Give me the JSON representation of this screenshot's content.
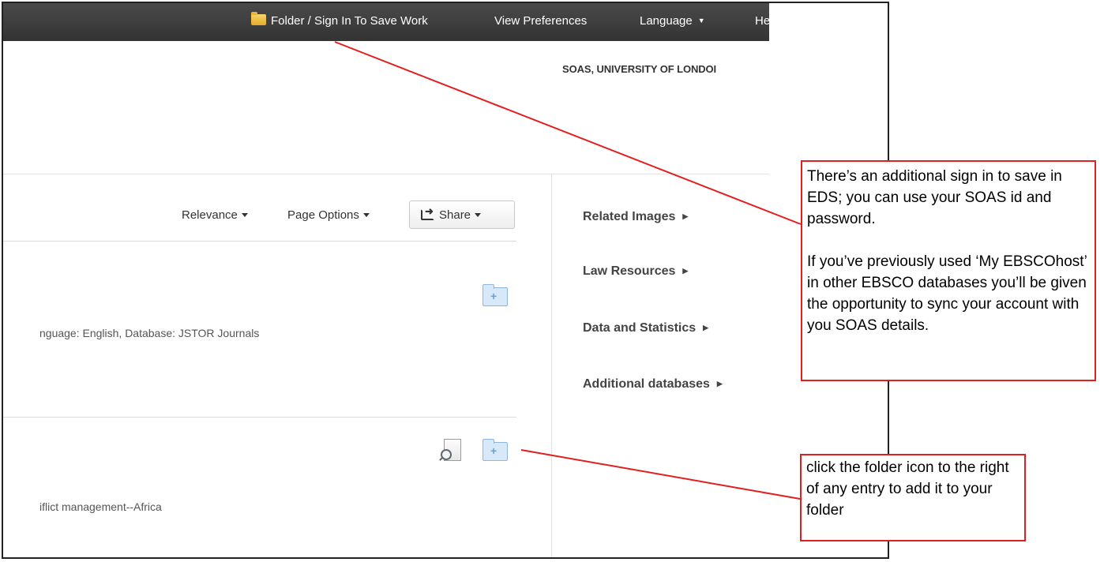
{
  "topbar": {
    "folder_link": "Folder / Sign In To Save Work",
    "view_preferences": "View Preferences",
    "language": "Language",
    "help_partial": "He"
  },
  "header": {
    "institution": "SOAS, UNIVERSITY OF LONDOI"
  },
  "toolbar": {
    "relevance": "Relevance",
    "page_options": "Page Options",
    "share": "Share"
  },
  "results": [
    {
      "snippet": "nguage: English, Database: JSTOR Journals"
    },
    {
      "snippet": "iflict management--Africa"
    }
  ],
  "sidebar": {
    "links": [
      "Related Images",
      "Law Resources",
      "Data and Statistics",
      "Additional databases"
    ]
  },
  "callouts": {
    "sign_in": {
      "paragraph1": "There’s an additional sign in to save in EDS; you can use your SOAS id and password.",
      "paragraph2": "If you’ve previously used ‘My EBSCOhost’ in other EBSCO databases you’ll be given the opportunity to sync your account with you SOAS details."
    },
    "folder": {
      "text": "click the folder icon to the right of any entry to add it to your folder"
    }
  },
  "colors": {
    "topbar": "#3d3d3d",
    "annotation": "#e41e1e"
  }
}
